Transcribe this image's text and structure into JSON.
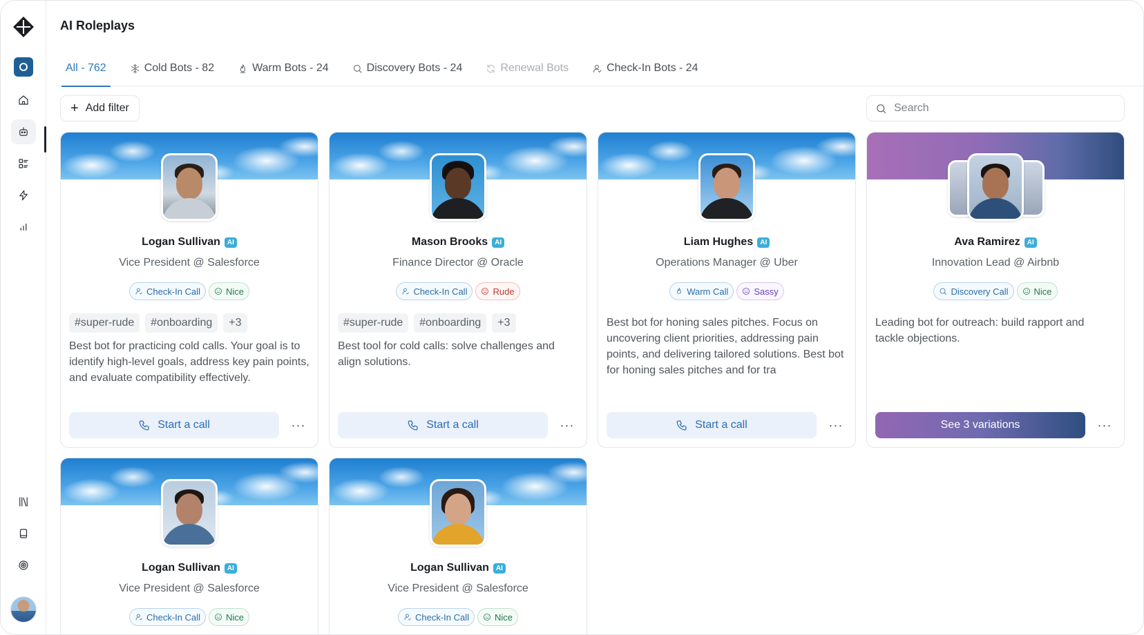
{
  "page": {
    "title": "AI Roleplays"
  },
  "tabs": [
    {
      "label": "All - 762",
      "icon": "none",
      "state": "active"
    },
    {
      "label": "Cold Bots - 82",
      "icon": "snowflake-icon",
      "state": "normal"
    },
    {
      "label": "Warm Bots - 24",
      "icon": "fire-icon",
      "state": "normal"
    },
    {
      "label": "Discovery Bots - 24",
      "icon": "search-icon",
      "state": "normal"
    },
    {
      "label": "Renewal Bots",
      "icon": "refresh-icon",
      "state": "disabled"
    },
    {
      "label": "Check-In Bots - 24",
      "icon": "user-icon",
      "state": "normal"
    }
  ],
  "toolbar": {
    "add_filter_label": "Add filter",
    "search_placeholder": "Search"
  },
  "ai_badge": "AI",
  "cards": [
    {
      "name": "Logan Sullivan",
      "role": "Vice President @ Salesforce",
      "pills": [
        {
          "label": "Check-In Call",
          "tone": "blue",
          "icon": "user-icon"
        },
        {
          "label": "Nice",
          "tone": "green",
          "icon": "smile-icon"
        }
      ],
      "tags": [
        "#super-rude",
        "#onboarding",
        "+3"
      ],
      "description": "Best bot for practicing cold calls. Your goal is to identify high-level goals, address key pain points, and evaluate compatibility effectively.",
      "cta": "Start a call",
      "more": "···"
    },
    {
      "name": "Mason Brooks",
      "role": "Finance Director @ Oracle",
      "pills": [
        {
          "label": "Check-In Call",
          "tone": "blue",
          "icon": "user-icon"
        },
        {
          "label": "Rude",
          "tone": "red",
          "icon": "angry-icon"
        }
      ],
      "tags": [
        "#super-rude",
        "#onboarding",
        "+3"
      ],
      "description": "Best tool for cold calls: solve challenges and align solutions.",
      "cta": "Start a call",
      "more": "···"
    },
    {
      "name": "Liam Hughes",
      "role": "Operations Manager @ Uber",
      "pills": [
        {
          "label": "Warm Call",
          "tone": "blue",
          "icon": "fire-icon"
        },
        {
          "label": "Sassy",
          "tone": "purple",
          "icon": "smile-icon"
        }
      ],
      "tags": [],
      "description": "Best bot for honing sales pitches. Focus on uncovering client priorities, addressing pain points, and delivering tailored solutions. Best bot for honing sales pitches and for tra",
      "cta": "Start a call",
      "more": "···"
    },
    {
      "name": "Ava Ramirez",
      "role": "Innovation Lead @ Airbnb",
      "pills": [
        {
          "label": "Discovery Call",
          "tone": "blue",
          "icon": "search-icon"
        },
        {
          "label": "Nice",
          "tone": "green",
          "icon": "smile-icon"
        }
      ],
      "tags": [],
      "description": "Leading bot for outreach: build rapport and tackle objections.",
      "cta": "See 3 variations",
      "more": "···"
    },
    {
      "name": "Logan Sullivan",
      "role": "Vice President @ Salesforce",
      "pills": [
        {
          "label": "Check-In Call",
          "tone": "blue",
          "icon": "user-icon"
        },
        {
          "label": "Nice",
          "tone": "green",
          "icon": "smile-icon"
        }
      ],
      "tags": [],
      "description": "",
      "cta": "",
      "more": ""
    },
    {
      "name": "Logan Sullivan",
      "role": "Vice President @ Salesforce",
      "pills": [
        {
          "label": "Check-In Call",
          "tone": "blue",
          "icon": "user-icon"
        },
        {
          "label": "Nice",
          "tone": "green",
          "icon": "smile-icon"
        }
      ],
      "tags": [],
      "description": "",
      "cta": "",
      "more": ""
    }
  ],
  "sidebar": {
    "icons": [
      "logo-icon",
      "workspace-icon",
      "home-icon",
      "bot-icon",
      "dashboard-icon",
      "bolt-icon",
      "chart-icon",
      "library-icon",
      "book-icon",
      "target-icon",
      "user-avatar"
    ]
  },
  "colors": {
    "accent": "#2b78b8",
    "cta_bg": "#eaf1fb",
    "ai_badge": "#3aaed8"
  }
}
